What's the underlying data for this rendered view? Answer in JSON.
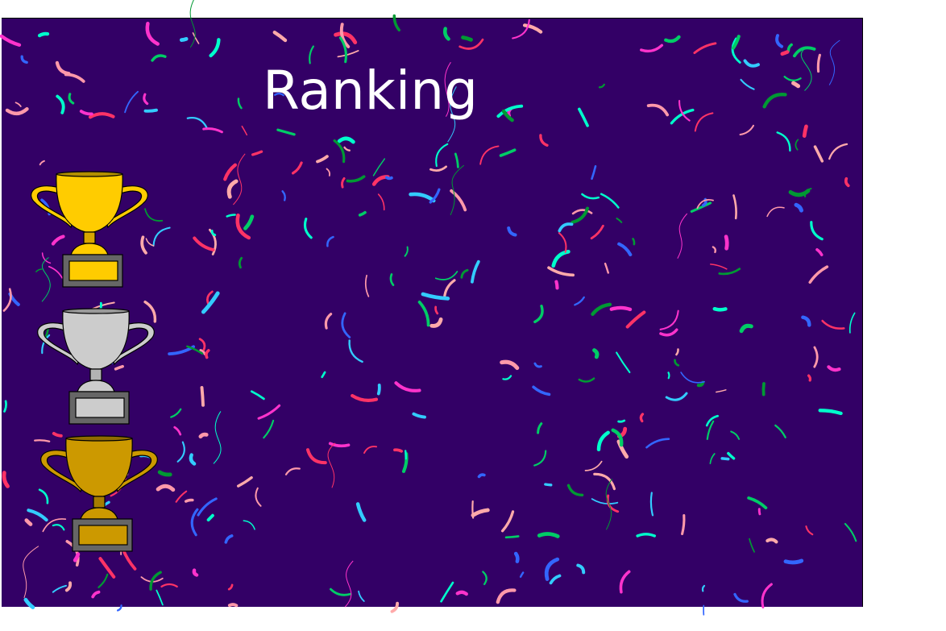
{
  "title": "Ranking",
  "colors": {
    "background": "#330066",
    "title_text": "#ffffff",
    "gold": "#ffcc00",
    "silver": "#cccccc",
    "bronze": "#cc9900",
    "trophy_base": "#666666"
  },
  "trophies": [
    {
      "rank": 1,
      "icon": "gold-trophy-icon",
      "color": "#ffcc00"
    },
    {
      "rank": 2,
      "icon": "silver-trophy-icon",
      "color": "#cccccc"
    },
    {
      "rank": 3,
      "icon": "bronze-trophy-icon",
      "color": "#cc9900"
    }
  ],
  "decoration": "confetti",
  "confetti_palette": [
    "#00cc66",
    "#33ccff",
    "#ff3366",
    "#ff99aa",
    "#3366ff",
    "#ff33cc",
    "#00ffcc",
    "#009933",
    "#ffaaaa"
  ]
}
